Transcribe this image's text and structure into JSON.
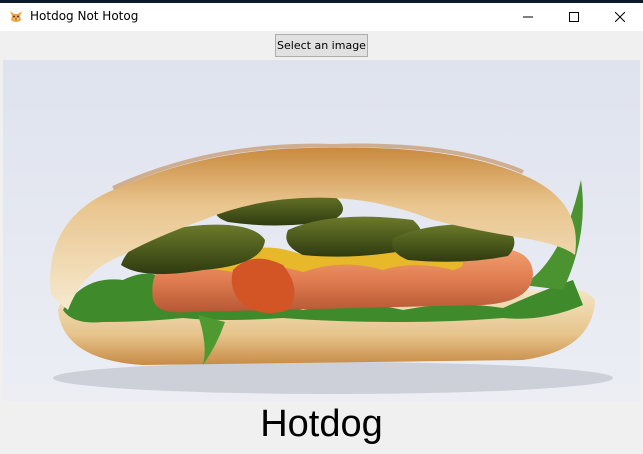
{
  "window": {
    "title": "Hotdog Not Hotog",
    "icon": "shiba-dog-icon",
    "controls": [
      "minimize-icon",
      "maximize-icon",
      "close-icon"
    ]
  },
  "toolbar": {
    "select_label": "Select an image"
  },
  "image": {
    "subject": "hotdog-photo"
  },
  "result": {
    "label": "Hotdog"
  },
  "colors": {
    "titlebar_bg": "#ffffff",
    "window_bg": "#f0f0f0",
    "button_bg": "#e1e1e1",
    "button_border": "#adadad"
  }
}
